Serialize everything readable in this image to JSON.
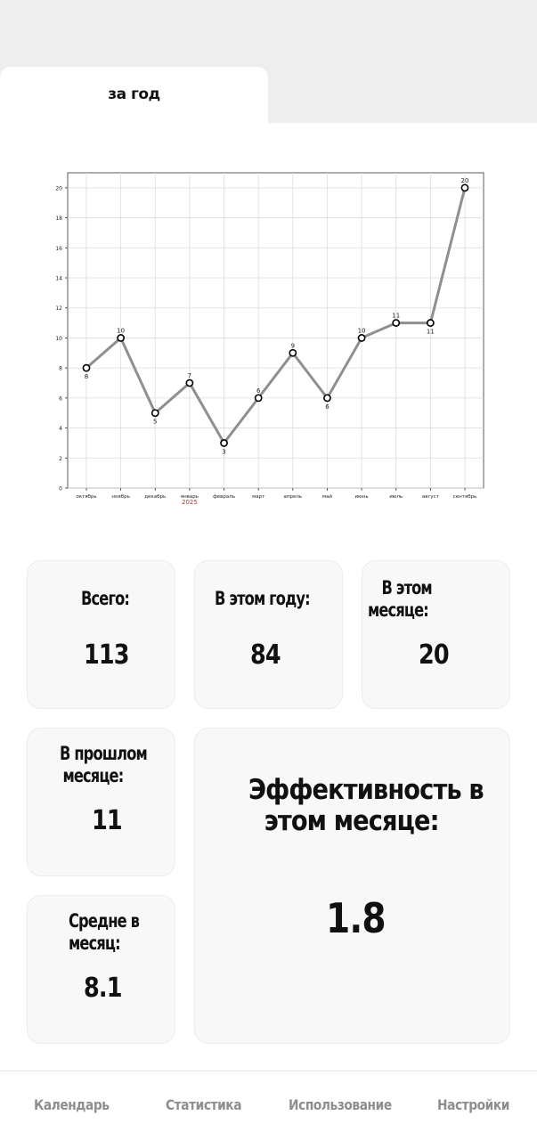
{
  "tabs": {
    "active_label": "за год"
  },
  "chart_data": {
    "type": "line",
    "categories": [
      "октябрь",
      "ноябрь",
      "декабрь",
      "январь",
      "февраль",
      "март",
      "апрель",
      "май",
      "июнь",
      "июль",
      "август",
      "сентябрь"
    ],
    "values": [
      8,
      10,
      5,
      7,
      3,
      6,
      9,
      6,
      10,
      11,
      11,
      20
    ],
    "data_labels": [
      "8",
      "10",
      "5",
      "7",
      "3",
      "6",
      "9",
      "6",
      "10",
      "11",
      "11",
      "20"
    ],
    "year_marker": "2025",
    "ylim": [
      0,
      21
    ],
    "yticks": [
      0,
      2,
      4,
      6,
      8,
      10,
      12,
      14,
      16,
      18,
      20
    ],
    "ytick_labels": [
      "0",
      "2",
      "4",
      "6",
      "8",
      "10",
      "12",
      "14",
      "16",
      "18",
      "20"
    ],
    "grid": true,
    "colors": {
      "line": "#8f8f8f",
      "marker_edge": "#000000",
      "marker_fill": "#ffffff",
      "grid": "#dddddd",
      "year_marker": "#b0342c"
    }
  },
  "stats": {
    "total": {
      "label": "Всего:",
      "value": "113"
    },
    "this_year": {
      "label": "В этом году:",
      "value": "84"
    },
    "this_month": {
      "label_line1": "В этом",
      "label_line2": "месяце:",
      "value": "20"
    },
    "last_month": {
      "label_line1": "В прошлом",
      "label_line2": "месяце:",
      "value": "11"
    },
    "avg_month": {
      "label_line1": "Средне в",
      "label_line2": "месяц:",
      "value": "8.1"
    },
    "efficiency": {
      "label_line1": "Эффективность в",
      "label_line2": "этом месяце:",
      "value": "1.8"
    }
  },
  "nav": {
    "calendar": "Календарь",
    "statistics": "Статистика",
    "usage": "Использование",
    "settings": "Настройки"
  }
}
